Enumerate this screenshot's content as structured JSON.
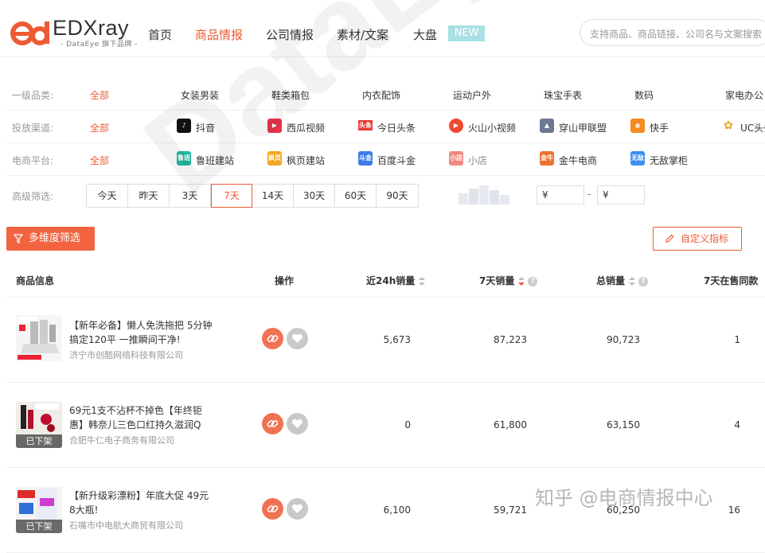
{
  "brand": {
    "name": "EDXray",
    "sub": "- DataEye 旗下品牌 -"
  },
  "nav": {
    "items": [
      "首页",
      "商品情报",
      "公司情报",
      "素材/文案",
      "大盘"
    ],
    "active": "商品情报",
    "new_badge": "NEW"
  },
  "search": {
    "placeholder": "支持商品、商品链接、公司名与文案搜索"
  },
  "filters": {
    "category": {
      "label": "一级品类:",
      "all": "全部",
      "options": [
        "女装男装",
        "鞋类箱包",
        "内衣配饰",
        "运动户外",
        "珠宝手表",
        "数码",
        "家电办公"
      ]
    },
    "channel": {
      "label": "投放渠道:",
      "all": "全部",
      "options": [
        {
          "name": "抖音",
          "icon": "douyin-icon",
          "color": "#111111"
        },
        {
          "name": "西瓜视频",
          "icon": "xigua-icon",
          "color": "#e8334c"
        },
        {
          "name": "今日头条",
          "icon": "toutiao-icon",
          "color": "#e83a33",
          "icon_text": "头条"
        },
        {
          "name": "火山小视频",
          "icon": "huoshan-icon",
          "color": "#f04830"
        },
        {
          "name": "穿山甲联盟",
          "icon": "pangle-icon",
          "color": "#6d7893"
        },
        {
          "name": "快手",
          "icon": "kuaishou-icon",
          "color": "#f58a1f"
        },
        {
          "name": "UC头条",
          "icon": "uc-icon",
          "color": "#e6a51d"
        }
      ]
    },
    "platform": {
      "label": "电商平台:",
      "all": "全部",
      "options": [
        {
          "name": "鲁班建站",
          "icon": "luban-icon",
          "color": "#22b8a0",
          "icon_text": "鲁班"
        },
        {
          "name": "枫页建站",
          "icon": "fengye-icon",
          "color": "#f5a623",
          "icon_text": "枫页"
        },
        {
          "name": "百度斗金",
          "icon": "doujin-icon",
          "color": "#3b7be8",
          "icon_text": "斗金"
        },
        {
          "name": "小店",
          "icon": "xiaodian-icon",
          "color": "#f08a80",
          "icon_text": "小店"
        },
        {
          "name": "金牛电商",
          "icon": "jinniu-icon",
          "color": "#f07030",
          "icon_text": "金牛"
        },
        {
          "name": "无敌掌柜",
          "icon": "wudi-icon",
          "color": "#3b8ff0",
          "icon_text": "无敌"
        }
      ]
    },
    "advanced": {
      "label": "高级筛选:",
      "days": [
        "今天",
        "昨天",
        "3天",
        "7天",
        "14天",
        "30天",
        "60天",
        "90天"
      ],
      "selected": "7天",
      "price_symbol": "¥",
      "price_sep": "-"
    }
  },
  "toolbar": {
    "multi_filter": "多维度筛选",
    "custom_metrics": "自定义指标"
  },
  "table": {
    "headers": [
      "商品信息",
      "操作",
      "近24h销量",
      "7天销量",
      "总销量",
      "7天在售同款"
    ],
    "rows": [
      {
        "title": "【新年必备】懒人免洗拖把 5分钟搞定120平 一推瞬间干净!",
        "company": "济宁市创酷网络科技有限公司",
        "sales24h": "5,673",
        "sales7d": "87,223",
        "total": "90,723",
        "same": "1",
        "status": ""
      },
      {
        "title": "69元1支不沾杯不掉色【年终钜惠】韩奈儿三色口红持久滋润Q",
        "company": "合肥牛仁电子商务有限公司",
        "sales24h": "0",
        "sales7d": "61,800",
        "total": "63,150",
        "same": "4",
        "status": "已下架"
      },
      {
        "title": "【新升级彩漂粉】年底大促 49元8大瓶!",
        "company": "石嘴市中电航大商贸有限公司",
        "sales24h": "6,100",
        "sales7d": "59,721",
        "total": "60,250",
        "same": "16",
        "status": "已下架"
      }
    ]
  },
  "watermark": "DataEye",
  "credit": "知乎 @电商情报中心"
}
